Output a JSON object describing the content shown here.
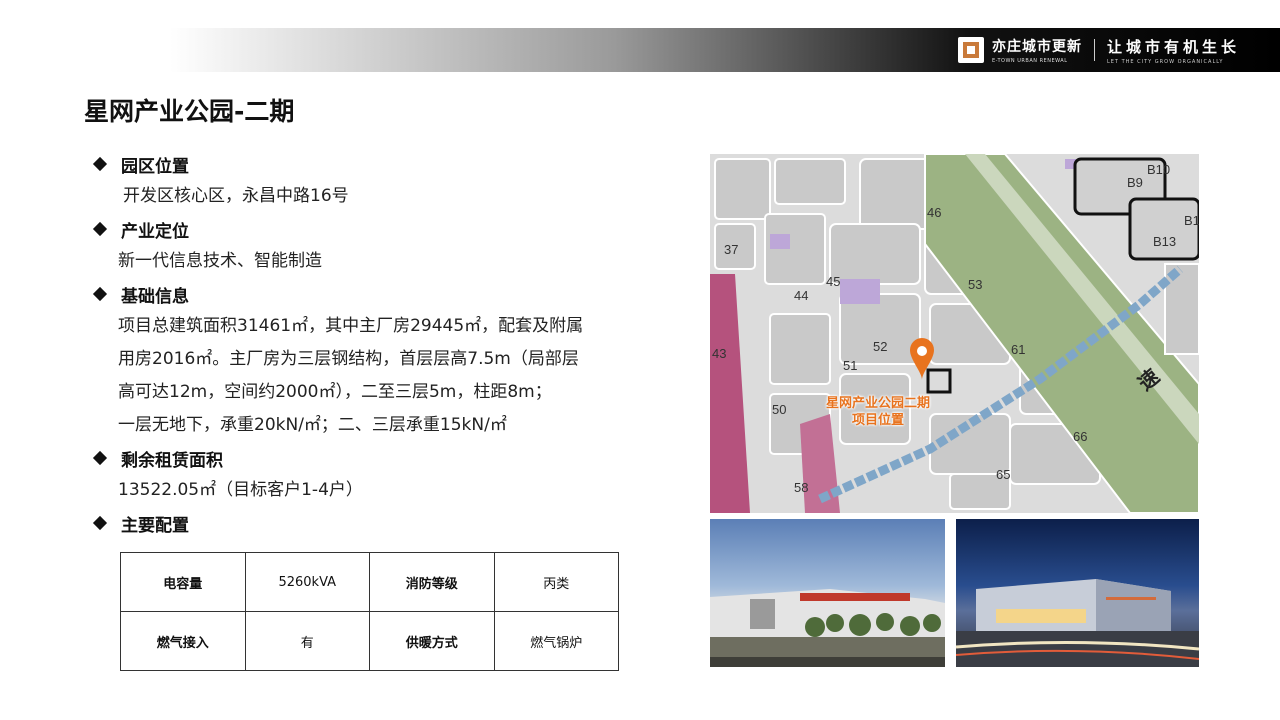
{
  "header": {
    "brand_cn": "亦庄城市更新",
    "brand_en": "E-TOWN URBAN RENEWAL",
    "slogan_cn": "让城市有机生长",
    "slogan_en": "LET THE CITY GROW ORGANICALLY"
  },
  "page_title": "星网产业公园-二期",
  "sections": [
    {
      "heading": "园区位置",
      "lines": [
        "开发区核心区，永昌中路16号"
      ]
    },
    {
      "heading": "产业定位",
      "lines": [
        "新一代信息技术、智能制造"
      ]
    },
    {
      "heading": "基础信息",
      "lines": [
        "项目总建筑面积31461㎡，其中主厂房29445㎡，配套及附属",
        "用房2016㎡。主厂房为三层钢结构，首层层高7.5m（局部层",
        "高可达12m，空间约2000㎡），二至三层5m，柱距8m；",
        "一层无地下，承重20kN/㎡；二、三层承重15kN/㎡"
      ]
    },
    {
      "heading": "剩余租赁面积",
      "lines": [
        "13522.05㎡（目标客户1-4户）"
      ]
    },
    {
      "heading": "主要配置",
      "lines": []
    }
  ],
  "config_table": [
    [
      "电容量",
      "5260kVA",
      "消防等级",
      "丙类"
    ],
    [
      "燃气接入",
      "有",
      "供暖方式",
      "燃气锅炉"
    ]
  ],
  "map": {
    "marker_label_line1": "星网产业公园二期",
    "marker_label_line2": "项目位置",
    "block_numbers": [
      "37",
      "44",
      "45",
      "46",
      "50",
      "51",
      "52",
      "53",
      "58",
      "61",
      "65",
      "66",
      "43",
      "B9",
      "B10",
      "B13",
      "B1"
    ],
    "road_label": "速"
  },
  "colors": {
    "marker": "#e8731e",
    "greenbelt": "#9cb383",
    "rail": "#7fa6c8",
    "purple": "#bda7d8",
    "magenta": "#b5527d"
  }
}
